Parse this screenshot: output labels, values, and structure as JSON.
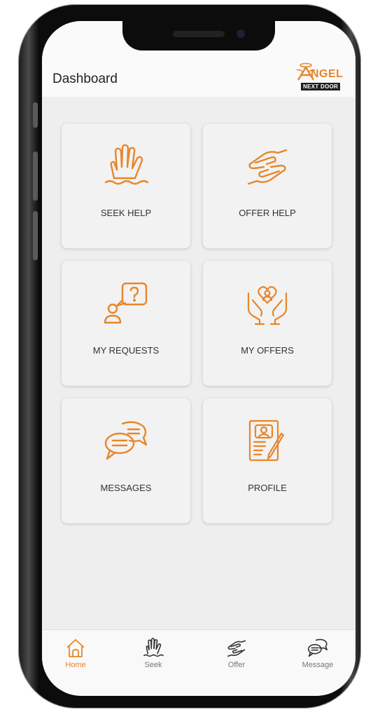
{
  "header": {
    "title": "Dashboard",
    "logo_text": "NGEL",
    "logo_sub": "NEXT DOOR"
  },
  "tiles": [
    {
      "label": "SEEK HELP",
      "icon": "raised-hand-icon"
    },
    {
      "label": "OFFER HELP",
      "icon": "giving-hands-icon"
    },
    {
      "label": "MY REQUESTS",
      "icon": "person-question-icon"
    },
    {
      "label": "MY OFFERS",
      "icon": "heart-hands-icon"
    },
    {
      "label": "MESSAGES",
      "icon": "chat-bubbles-icon"
    },
    {
      "label": "PROFILE",
      "icon": "profile-document-icon"
    }
  ],
  "bottom_nav": [
    {
      "label": "Home",
      "icon": "home-icon",
      "active": true
    },
    {
      "label": "Seek",
      "icon": "raised-hand-icon",
      "active": false
    },
    {
      "label": "Offer",
      "icon": "giving-hands-icon",
      "active": false
    },
    {
      "label": "Message",
      "icon": "chat-bubbles-icon",
      "active": false
    }
  ],
  "colors": {
    "accent": "#e8862a",
    "background": "#eeeeee",
    "tile": "#f2f2f2"
  }
}
